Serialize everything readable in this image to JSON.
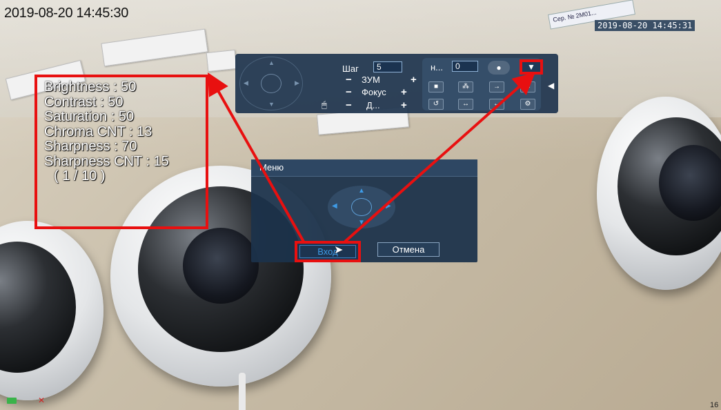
{
  "osd": {
    "timestamp_left": "2019-08-20 14:45:30",
    "timestamp_right": "2019-08-20 14:45:31",
    "corner_text": "16",
    "sticker_text": "Сер. № 2М01..."
  },
  "info": {
    "lines": [
      "Brightness : 50",
      "Contrast : 50",
      "Saturation : 50",
      "Chroma CNT : 13",
      "Sharpness : 70",
      "Sharpness CNT : 15"
    ],
    "page": "( 1 / 10 )"
  },
  "ptz": {
    "step_label": "Шаг",
    "step_value": "5",
    "zoom_label": "ЗУМ",
    "focus_label": "Фокус",
    "iris_label": "Д...",
    "preset_label": "н...",
    "preset_value": "0",
    "minus": "−",
    "plus": "+"
  },
  "dialog": {
    "title": "Меню",
    "enter_label": "Вход",
    "cancel_label": "Отмена"
  },
  "colors": {
    "highlight": "#e81010",
    "panel": "#1e344e",
    "accent": "#3e9be6"
  }
}
